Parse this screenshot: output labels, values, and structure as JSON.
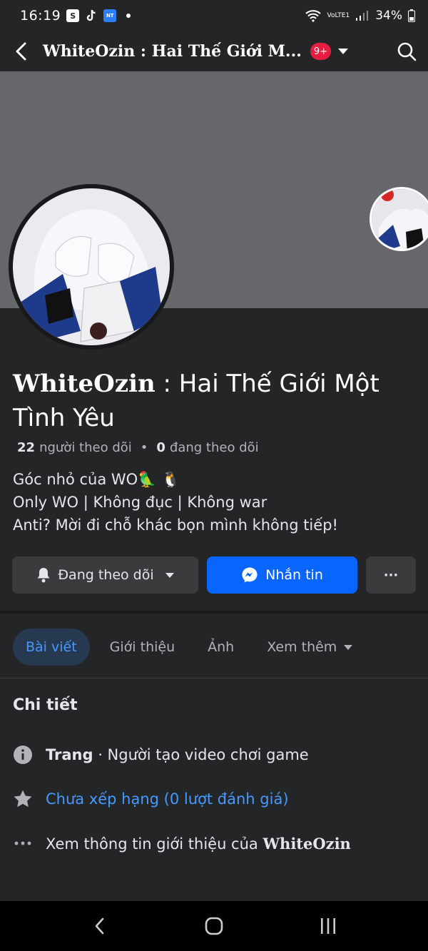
{
  "status_bar": {
    "time": "16:19",
    "network": "VoLTE1",
    "battery": "34%"
  },
  "app_bar": {
    "title": "WhiteOzin : Hai Thế Giới M...",
    "notification_badge": "9+"
  },
  "profile": {
    "name_brand": "WhiteOzin",
    "name_rest": " : Hai Thế Giới Một Tình Yêu",
    "followers_count": "22",
    "followers_label": "người theo dõi",
    "following_count": "0",
    "following_label": "đang theo dõi",
    "bio_line1": "Góc nhỏ của WO🦜 🐧",
    "bio_line2": "Only WO | Không đục | Không war",
    "bio_line3": "Anti? Mời đi chỗ khác bọn mình không tiếp!"
  },
  "actions": {
    "follow_label": "Đang theo dõi",
    "message_label": "Nhắn tin",
    "more_label": "···"
  },
  "tabs": [
    {
      "label": "Bài viết",
      "active": true
    },
    {
      "label": "Giới thiệu",
      "active": false
    },
    {
      "label": "Ảnh",
      "active": false
    },
    {
      "label": "Xem thêm",
      "active": false
    }
  ],
  "details": {
    "title": "Chi tiết",
    "page_type_bold": "Trang",
    "page_type_rest": " · Người tạo video chơi game",
    "rating": "Chưa xếp hạng (0 lượt đánh giá)",
    "about_prefix": "Xem thông tin giới thiệu của ",
    "about_name": "WhiteOzin"
  },
  "colors": {
    "background": "#242526",
    "cover": "#65676b",
    "accent_blue": "#0866ff",
    "link_blue": "#4599ff",
    "badge_red": "#e41e3f"
  }
}
